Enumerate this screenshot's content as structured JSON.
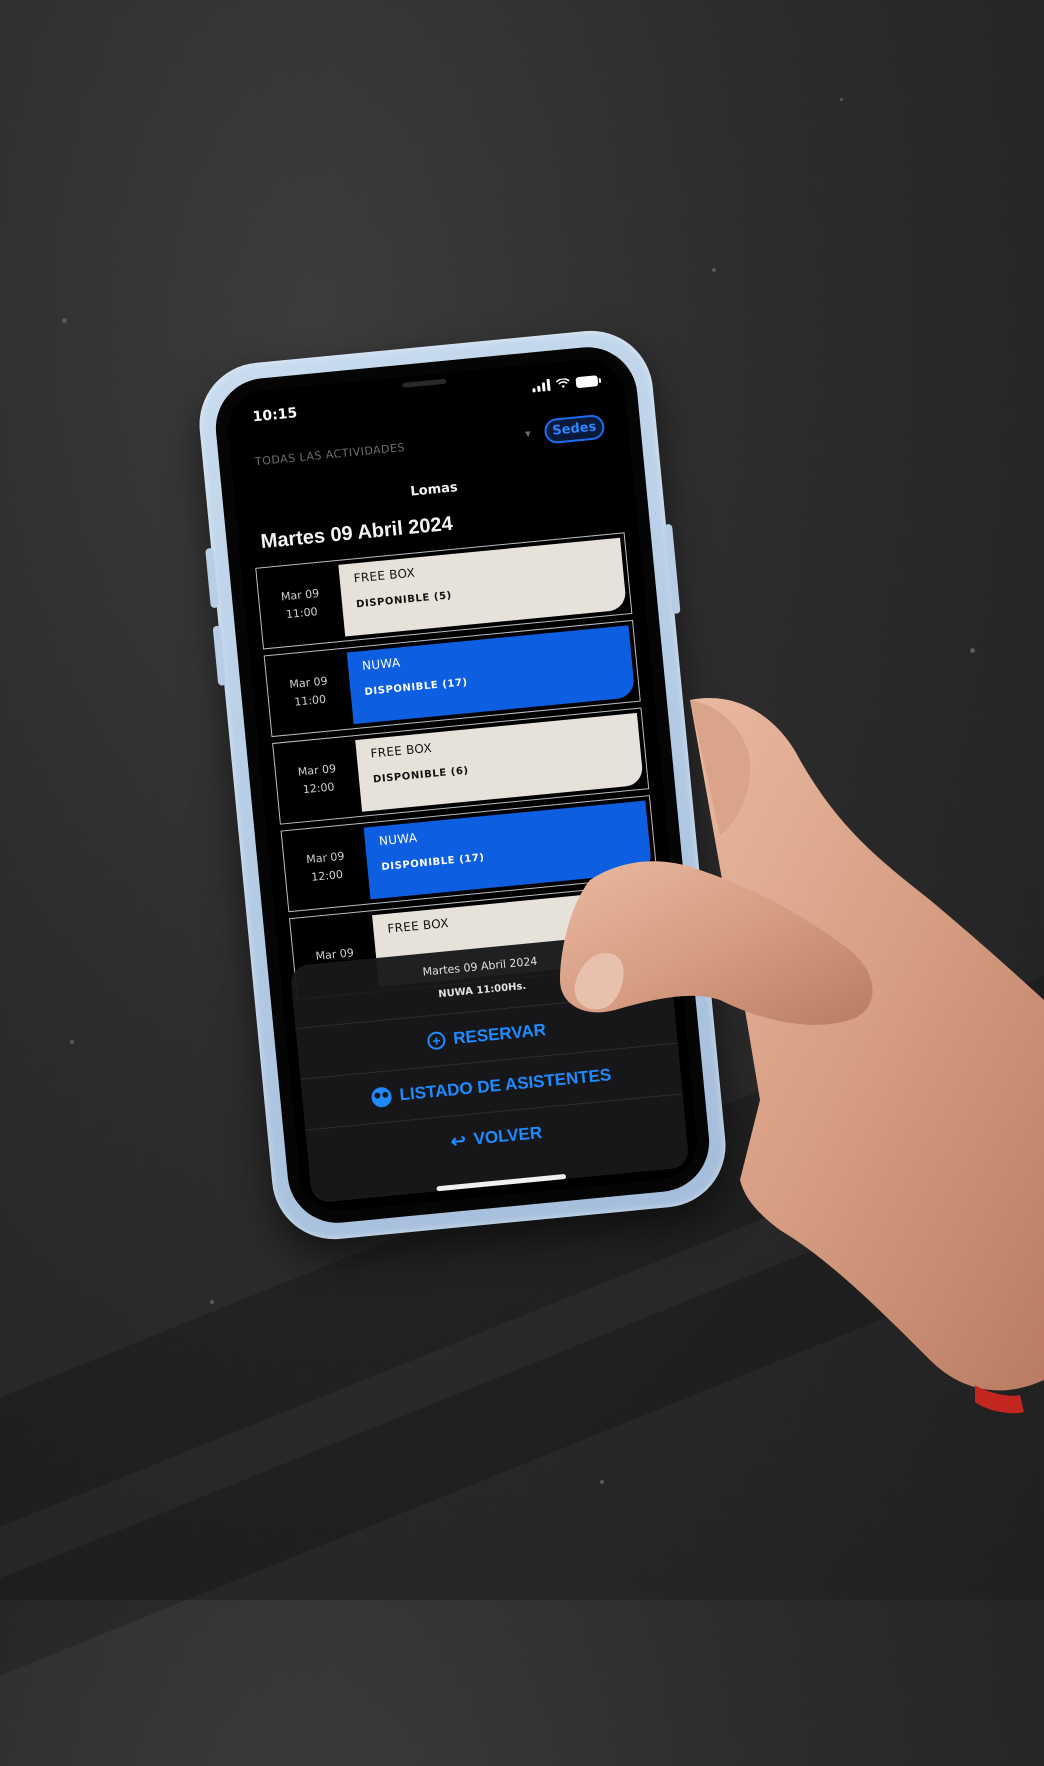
{
  "status_bar": {
    "time": "10:15"
  },
  "header": {
    "filter_label": "TODAS LAS ACTIVIDADES",
    "filter_chevron": "chevron-down-icon",
    "sedes_label": "Sedes"
  },
  "venue": "Lomas",
  "day_title": "Martes 09 Abril 2024",
  "slots": [
    {
      "date": "Mar 09",
      "time": "11:00",
      "name": "FREE BOX",
      "status": "DISPONIBLE (5)",
      "style": "light"
    },
    {
      "date": "Mar 09",
      "time": "11:00",
      "name": "NUWA",
      "status": "DISPONIBLE (17)",
      "style": "blue"
    },
    {
      "date": "Mar 09",
      "time": "12:00",
      "name": "FREE BOX",
      "status": "DISPONIBLE (6)",
      "style": "light"
    },
    {
      "date": "Mar 09",
      "time": "12:00",
      "name": "NUWA",
      "status": "DISPONIBLE (17)",
      "style": "blue"
    },
    {
      "date": "Mar 09",
      "time": "",
      "name": "FREE BOX",
      "status": "",
      "style": "light"
    }
  ],
  "sheet": {
    "date": "Martes 09 Abril 2024",
    "activity": "NUWA 11:00Hs.",
    "actions": [
      {
        "label": "RESERVAR",
        "icon": "plus-circle-icon"
      },
      {
        "label": "LISTADO DE ASISTENTES",
        "icon": "people-icon"
      },
      {
        "label": "VOLVER",
        "icon": "back-arrow-icon"
      }
    ]
  },
  "colors": {
    "accent": "#1f8bff",
    "card_blue": "#0d5ee0",
    "card_light": "#e6e2da",
    "case": "#b3cbe4"
  }
}
